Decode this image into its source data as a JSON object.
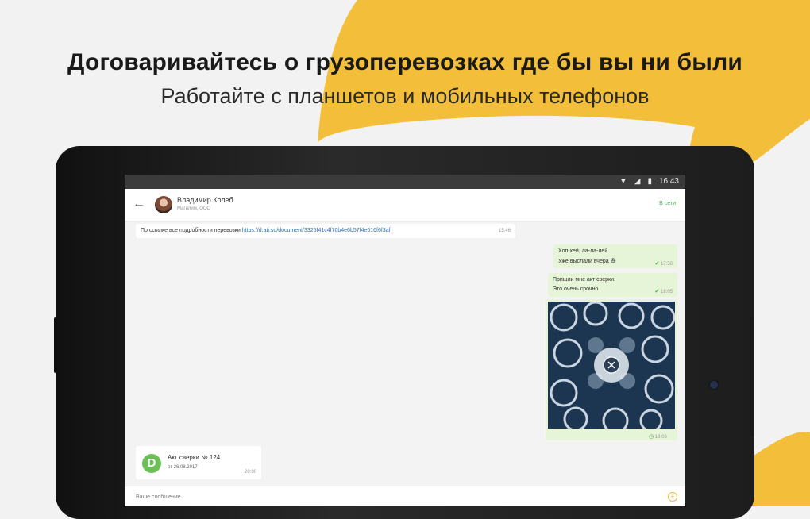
{
  "headline": {
    "title": "Договаривайтесь о грузоперевозках где бы вы ни были",
    "subtitle": "Работайте с планшетов и мобильных телефонов"
  },
  "colors": {
    "accent_yellow": "#f3bf3a",
    "background": "#f2f2f2",
    "bubble_out": "#e6f4d7",
    "online_green": "#4caf50",
    "link_blue": "#2b6cb8"
  },
  "statusbar": {
    "time": "16:43",
    "icons": [
      "wifi-icon",
      "signal-icon",
      "battery-icon"
    ]
  },
  "appbar": {
    "contact_name": "Владимир Колеб",
    "contact_subtitle": "Магнлим, ООО",
    "online_status": "В сети"
  },
  "messages": {
    "m1": {
      "text": "По ссылке все подробности перевозки",
      "link": "https://d.ati.su/document/3325f41c4f70b4e6b57f4e616f6f3af",
      "time": "15:46"
    },
    "m2": {
      "line1": "Хоп-хей, ла-ла-лей",
      "line2": "Уже выслали вчера 😆",
      "time": "17:56"
    },
    "m3": {
      "line1": "Пришли мне акт сверки.",
      "line2": "Это очень срочно",
      "time": "18:05"
    },
    "m4": {
      "time": "18:06"
    },
    "doc": {
      "icon_letter": "D",
      "title": "Акт сверки № 124",
      "date": "от 26.08.2017",
      "time": "20:00"
    }
  },
  "composer": {
    "placeholder": "Ваше сообщение"
  }
}
